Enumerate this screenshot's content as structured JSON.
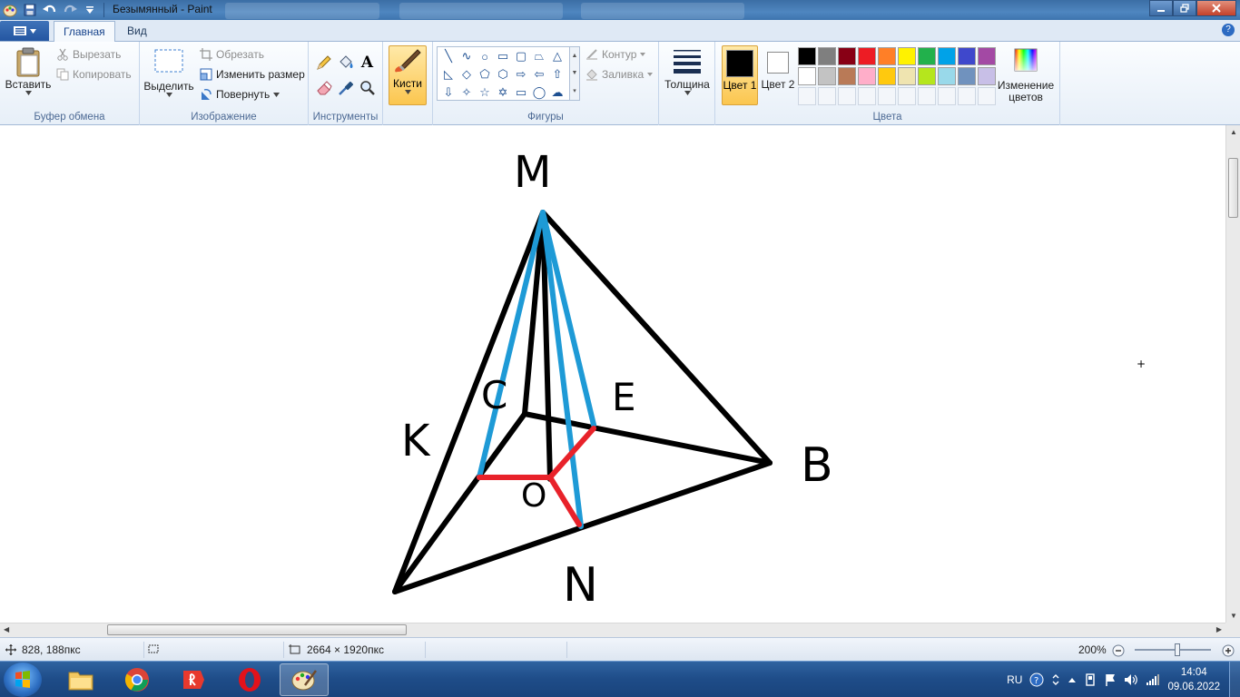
{
  "window": {
    "title": "Безымянный - Paint"
  },
  "tabs": {
    "file_icon": "menu-icon",
    "home": "Главная",
    "view": "Вид"
  },
  "clipboard": {
    "paste": "Вставить",
    "cut": "Вырезать",
    "copy": "Копировать",
    "group": "Буфер обмена"
  },
  "image": {
    "select": "Выделить",
    "crop": "Обрезать",
    "resize": "Изменить размер",
    "rotate": "Повернуть",
    "group": "Изображение"
  },
  "tools": {
    "group": "Инструменты",
    "items": [
      "pencil-icon",
      "fill-icon",
      "text-icon",
      "eraser-icon",
      "color-picker-icon",
      "magnifier-icon"
    ]
  },
  "brushes": {
    "label": "Кисти"
  },
  "shapes": {
    "group": "Фигуры",
    "outline": "Контур",
    "fill": "Заливка"
  },
  "size": {
    "label": "Толщина"
  },
  "colors": {
    "color1": "Цвет 1",
    "color2": "Цвет 2",
    "edit": "Изменение цветов",
    "group": "Цвета",
    "color1_value": "#000000",
    "color2_value": "#ffffff",
    "palette": [
      "#000000",
      "#7f7f7f",
      "#880015",
      "#ed1c24",
      "#ff7f27",
      "#fff200",
      "#22b14c",
      "#00a2e8",
      "#3f48cc",
      "#a349a4",
      "#ffffff",
      "#c3c3c3",
      "#b97a57",
      "#ffaec9",
      "#ffc90e",
      "#efe4b0",
      "#b5e61d",
      "#99d9ea",
      "#7092be",
      "#c8bfe7"
    ]
  },
  "drawing": {
    "labels": {
      "m": "M",
      "k": "K",
      "c": "C",
      "e": "E",
      "b": "B",
      "o": "O",
      "n": "N"
    },
    "colors": {
      "black": "#000000",
      "blue": "#1e9ad6",
      "red": "#e8222a"
    }
  },
  "status": {
    "cursor": "828, 188пкс",
    "size": "2664 × 1920пкс",
    "zoom": "200%"
  },
  "taskbar": {
    "lang": "RU",
    "time": "14:04",
    "date": "09.06.2022"
  }
}
